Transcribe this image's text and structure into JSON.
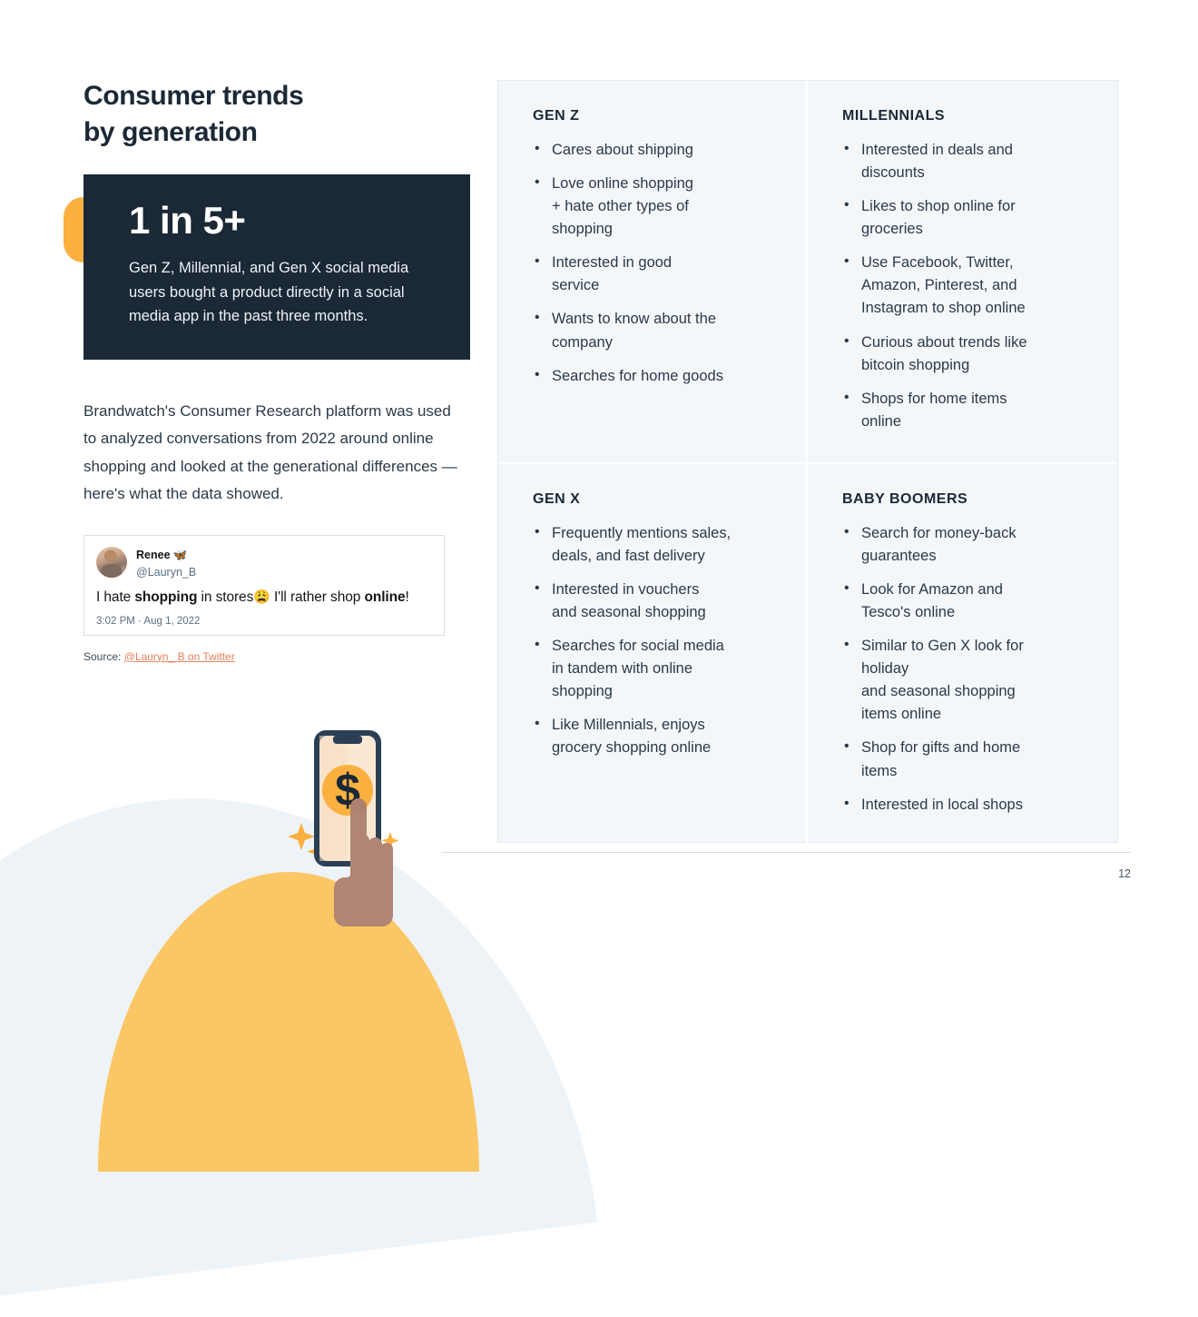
{
  "title": "Consumer trends\nby generation",
  "stat": {
    "figure": "1 in 5+",
    "description": "Gen Z, Millennial, and Gen X social media users bought a product directly in a social media app in the past three months."
  },
  "body_paragraph": "Brandwatch's Consumer Research platform was used to analyzed conversations from 2022 around online shopping and looked at the generational differences — here's what the data showed.",
  "tweet": {
    "display_name": "Renee",
    "verified_glyph": "🦋",
    "handle": "@Lauryn_B",
    "text_part1": "I hate ",
    "text_bold1": "shopping",
    "text_part2": " in stores",
    "emoji": "😩",
    "text_part3": " I'll rather shop ",
    "text_bold2": "online",
    "text_part4": "!",
    "timestamp": "3:02 PM · Aug 1, 2022"
  },
  "source": {
    "label": "Source: ",
    "link_text": "@Lauryn_ B on Twitter"
  },
  "quadrants": [
    {
      "id": "gen-z",
      "title": "GEN Z",
      "items": [
        "Cares about shipping",
        "Love online shopping\n+ hate other types of\nshopping",
        "Interested in good\nservice",
        "Wants to know about the\ncompany",
        "Searches for home goods"
      ]
    },
    {
      "id": "millennials",
      "title": "MILLENNIALS",
      "items": [
        "Interested in deals and\ndiscounts",
        "Likes to shop online for\ngroceries",
        "Use Facebook, Twitter,\nAmazon, Pinterest, and\nInstagram to shop online",
        "Curious about trends like\nbitcoin shopping",
        "Shops for home items\nonline"
      ]
    },
    {
      "id": "gen-x",
      "title": "GEN X",
      "items": [
        "Frequently mentions sales,\ndeals, and fast delivery",
        "Interested in vouchers\nand seasonal shopping",
        "Searches for social media\nin tandem with online\nshopping",
        "Like Millennials, enjoys\ngrocery shopping online"
      ]
    },
    {
      "id": "baby-boomers",
      "title": "BABY BOOMERS",
      "items": [
        "Search for money-back\nguarantees",
        "Look for Amazon and\nTesco's online",
        "Similar to Gen X look for\nholiday\nand seasonal shopping\nitems online",
        "Shop for gifts and home\nitems",
        "Interested in local shops"
      ]
    }
  ],
  "page_number": "12",
  "colors": {
    "dark": "#1b2836",
    "yellow": "#fbb040",
    "yellow_arc": "#fbc664",
    "panel_bg": "#f4f7fa",
    "pale_blue": "#eef3f8",
    "link": "#e98159"
  }
}
